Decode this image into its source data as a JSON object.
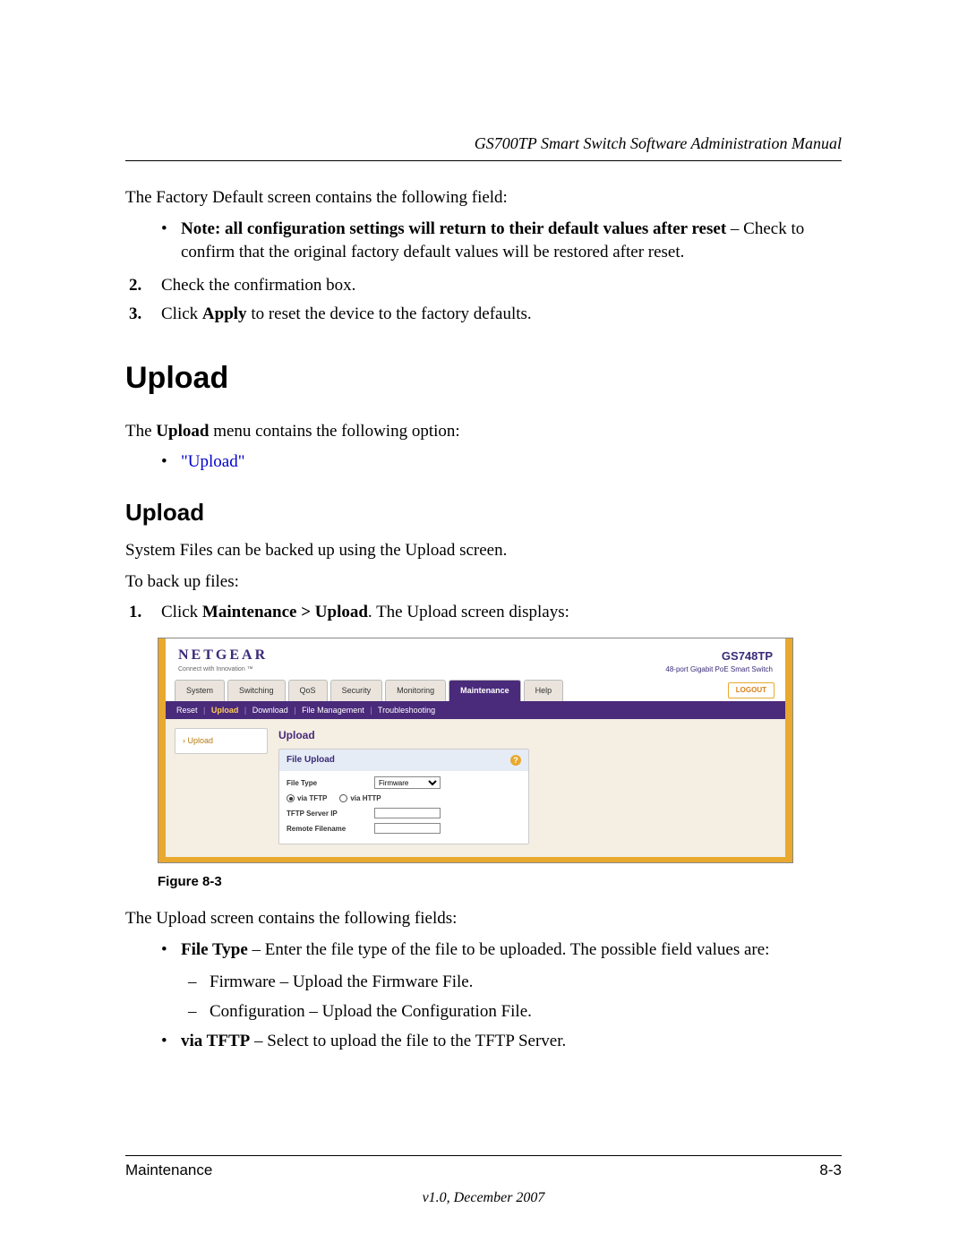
{
  "header": {
    "doc_title": "GS700TP Smart Switch Software Administration Manual"
  },
  "intro": {
    "line1": "The Factory Default screen contains the following field:",
    "note_bold": "Note: all configuration settings will return to their default values after reset",
    "note_rest": " – Check to confirm that the original factory default values will be restored after reset.",
    "step2": "Check the confirmation box.",
    "step3_a": "Click ",
    "step3_bold": "Apply",
    "step3_b": " to reset the device to the factory defaults."
  },
  "section": {
    "title": "Upload",
    "para1_a": "The ",
    "para1_bold": "Upload",
    "para1_b": " menu contains the following option:",
    "bullet_link": "\"Upload\"",
    "subtitle": "Upload",
    "para2": "System Files can be backed up using the Upload screen.",
    "para3": "To back up files:",
    "step1_a": "Click ",
    "step1_bold": "Maintenance > Upload",
    "step1_b": ". The Upload screen displays:"
  },
  "shot": {
    "logo": "NETGEAR",
    "tagline": "Connect with Innovation ™",
    "model": "GS748TP",
    "model_desc": "48-port Gigabit PoE Smart Switch",
    "tabs": [
      "System",
      "Switching",
      "QoS",
      "Security",
      "Monitoring",
      "Maintenance",
      "Help"
    ],
    "active_tab_index": 5,
    "logout": "LOGOUT",
    "subnav": {
      "items": [
        "Reset",
        "Upload",
        "Download",
        "File Management",
        "Troubleshooting"
      ],
      "highlight_index": 1
    },
    "side": {
      "item": "Upload"
    },
    "panel": {
      "title": "Upload",
      "head": "File Upload",
      "rows": {
        "file_type_label": "File Type",
        "file_type_value": "Firmware",
        "radio1": "via TFTP",
        "radio2": "via HTTP",
        "tftp_label": "TFTP Server IP",
        "remote_label": "Remote Filename"
      }
    }
  },
  "figure": {
    "caption": "Figure 8-3"
  },
  "after": {
    "line1": "The Upload screen contains the following fields:",
    "b1_bold": "File Type",
    "b1_rest": " – Enter the file type of the file to be uploaded. The possible field values are:",
    "s1": "Firmware – Upload the Firmware File.",
    "s2": "Configuration – Upload the Configuration File.",
    "b2_bold": "via TFTP",
    "b2_rest": " – Select to upload the file to the TFTP Server."
  },
  "footer": {
    "left": "Maintenance",
    "right": "8-3",
    "center": "v1.0, December 2007"
  }
}
